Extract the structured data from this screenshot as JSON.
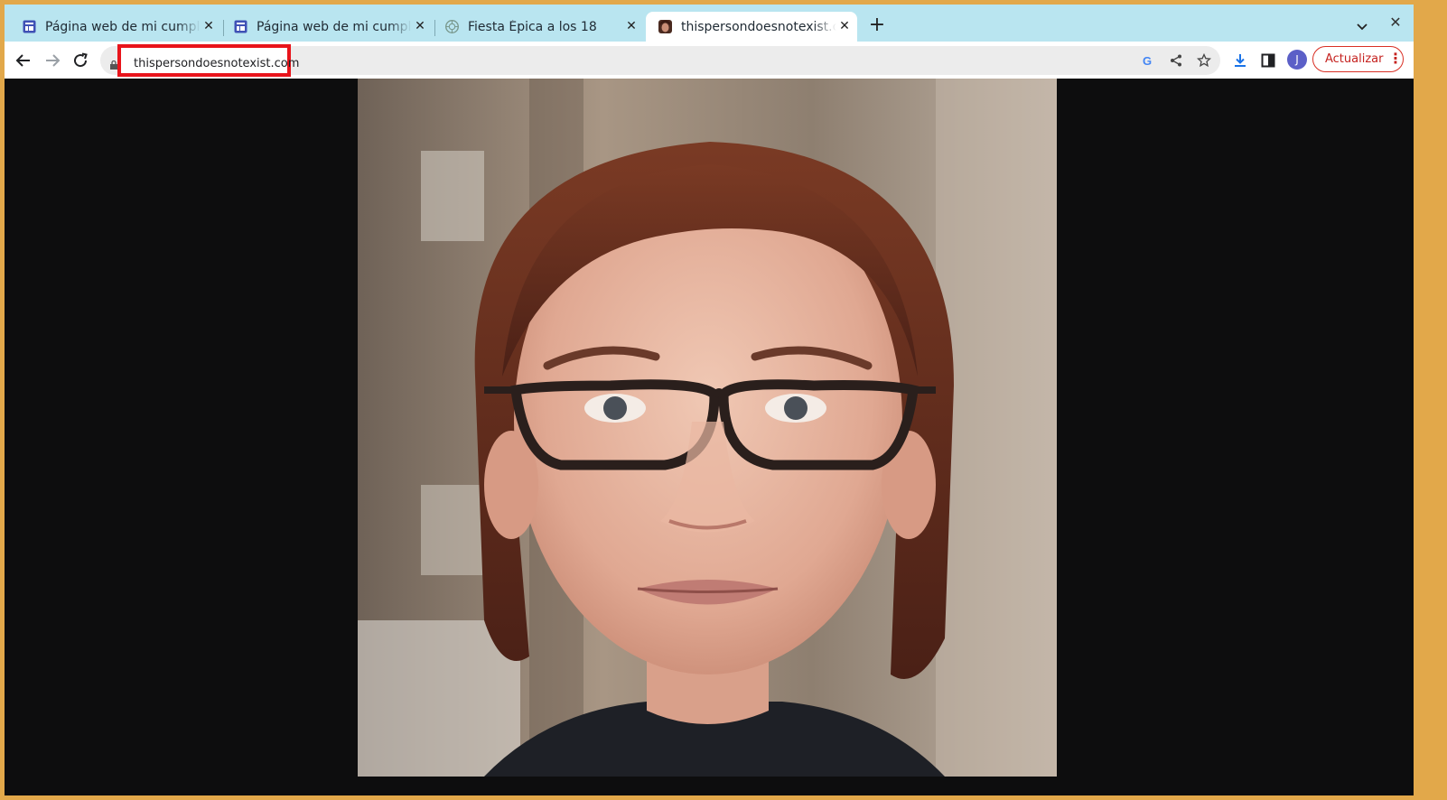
{
  "tabs": [
    {
      "title": "Página web de mi cumpleaños",
      "favicon": "sites-icon",
      "active": false
    },
    {
      "title": "Página web de mi cumpleaños",
      "favicon": "sites-icon",
      "active": false
    },
    {
      "title": "Fiesta Épica a los 18",
      "favicon": "chatgpt-icon",
      "active": false
    },
    {
      "title": "thispersondoesnotexist.com",
      "favicon": "face-favicon",
      "active": true
    }
  ],
  "toolbar": {
    "url": "thispersondoesnotexist.com",
    "update_label": "Actualizar",
    "profile_initial": "J"
  },
  "colors": {
    "tabstrip": "#b9e5f0",
    "highlight": "#e8141b",
    "page_background": "#0d0d0e",
    "update_button": "#d93025",
    "avatar": "#5b5fc7"
  },
  "main": {
    "image_alt": "Generated portrait of a woman with short auburn hair and dark-rimmed glasses"
  }
}
